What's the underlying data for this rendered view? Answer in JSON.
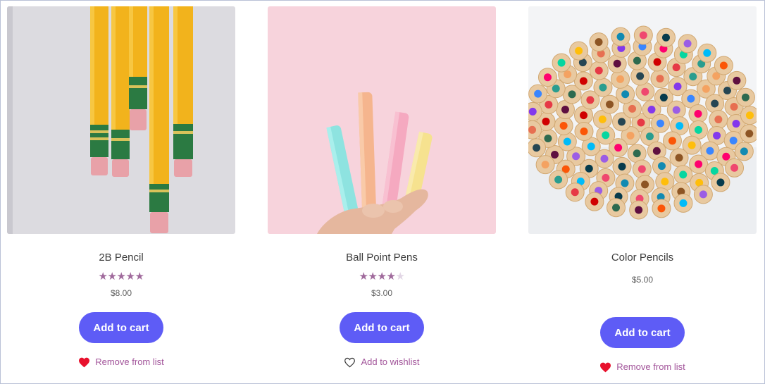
{
  "products": [
    {
      "title": "2B Pencil",
      "rating": 5,
      "price": "$8.00",
      "cart_label": "Add to cart",
      "wishlist_label": "Remove from list",
      "wishlisted": true,
      "image_icon": "yellow-pencils-image"
    },
    {
      "title": "Ball Point Pens",
      "rating": 4,
      "price": "$3.00",
      "cart_label": "Add to cart",
      "wishlist_label": "Add to wishlist",
      "wishlisted": false,
      "image_icon": "pastel-pens-image"
    },
    {
      "title": "Color Pencils",
      "rating": null,
      "price": "$5.00",
      "cart_label": "Add to cart",
      "wishlist_label": "Remove from list",
      "wishlisted": true,
      "image_icon": "color-pencils-image"
    }
  ],
  "colors": {
    "button": "#5e5cf6",
    "link": "#a2549a",
    "star_on": "#a06a9c",
    "heart": "#e8112d"
  }
}
